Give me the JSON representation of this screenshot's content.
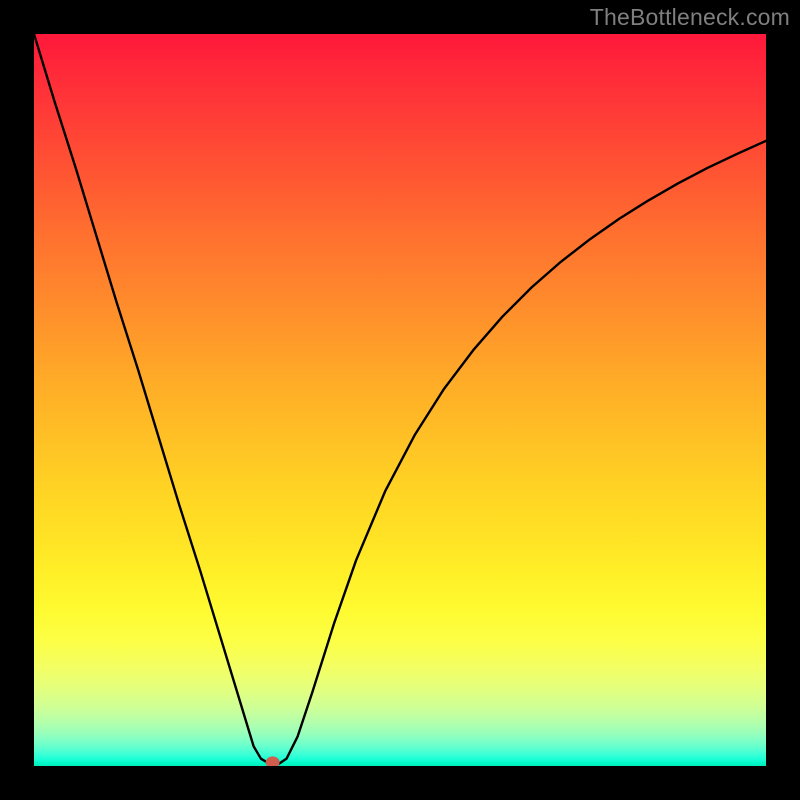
{
  "watermark": "TheBottleneck.com",
  "marker": {
    "x_frac": 0.326,
    "y_frac": 0.995,
    "rx": 7,
    "ry": 6
  },
  "chart_data": {
    "type": "line",
    "title": "",
    "xlabel": "",
    "ylabel": "",
    "xlim": [
      0,
      1
    ],
    "ylim": [
      0,
      1
    ],
    "annotations": [
      "TheBottleneck.com"
    ],
    "legend": [],
    "series": [
      {
        "name": "bottleneck-curve",
        "x": [
          0.0,
          0.028,
          0.057,
          0.085,
          0.113,
          0.142,
          0.17,
          0.198,
          0.227,
          0.255,
          0.283,
          0.3,
          0.31,
          0.32,
          0.326,
          0.333,
          0.345,
          0.36,
          0.38,
          0.41,
          0.44,
          0.48,
          0.52,
          0.56,
          0.6,
          0.64,
          0.68,
          0.72,
          0.76,
          0.8,
          0.84,
          0.88,
          0.92,
          0.96,
          1.0
        ],
        "y": [
          1.0,
          0.908,
          0.817,
          0.725,
          0.633,
          0.542,
          0.45,
          0.358,
          0.267,
          0.175,
          0.083,
          0.027,
          0.01,
          0.004,
          0.002,
          0.002,
          0.01,
          0.04,
          0.1,
          0.195,
          0.281,
          0.376,
          0.452,
          0.515,
          0.568,
          0.614,
          0.654,
          0.689,
          0.72,
          0.748,
          0.773,
          0.796,
          0.817,
          0.836,
          0.854
        ]
      }
    ],
    "gradient_stops": [
      {
        "pos": 0.0,
        "color": "#ff183b"
      },
      {
        "pos": 0.5,
        "color": "#ffc025"
      },
      {
        "pos": 0.8,
        "color": "#fcff46"
      },
      {
        "pos": 1.0,
        "color": "#00efba"
      }
    ]
  }
}
